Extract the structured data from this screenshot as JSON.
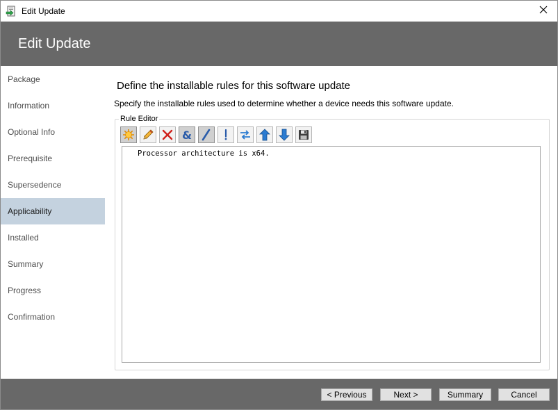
{
  "window": {
    "title": "Edit Update",
    "header_title": "Edit Update"
  },
  "sidebar": {
    "items": [
      {
        "label": "Package",
        "active": false
      },
      {
        "label": "Information",
        "active": false
      },
      {
        "label": "Optional Info",
        "active": false
      },
      {
        "label": "Prerequisite",
        "active": false
      },
      {
        "label": "Supersedence",
        "active": false
      },
      {
        "label": "Applicability",
        "active": true
      },
      {
        "label": "Installed",
        "active": false
      },
      {
        "label": "Summary",
        "active": false
      },
      {
        "label": "Progress",
        "active": false
      },
      {
        "label": "Confirmation",
        "active": false
      }
    ],
    "active_color": "#c4d2df"
  },
  "content": {
    "title": "Define the installable rules for this software update",
    "description": "Specify the installable rules used to determine whether a device needs this software update.",
    "group_label": "Rule Editor",
    "toolbar": [
      {
        "icon": "new-rule-icon",
        "pressed": true
      },
      {
        "icon": "edit-rule-icon",
        "pressed": false
      },
      {
        "icon": "delete-rule-icon",
        "pressed": false
      },
      {
        "icon": "and-operator-icon",
        "pressed": true
      },
      {
        "icon": "or-operator-icon",
        "pressed": true
      },
      {
        "icon": "not-operator-icon",
        "pressed": false
      },
      {
        "icon": "toggle-icon",
        "pressed": false
      },
      {
        "icon": "move-up-icon",
        "pressed": false
      },
      {
        "icon": "move-down-icon",
        "pressed": false
      },
      {
        "icon": "save-rule-icon",
        "pressed": false
      }
    ],
    "rules": [
      "Processor architecture is x64."
    ]
  },
  "footer": {
    "previous_label": "< Previous",
    "next_label": "Next >",
    "summary_label": "Summary",
    "cancel_label": "Cancel"
  },
  "colors": {
    "header_bg": "#686868",
    "footer_bg": "#686868"
  }
}
